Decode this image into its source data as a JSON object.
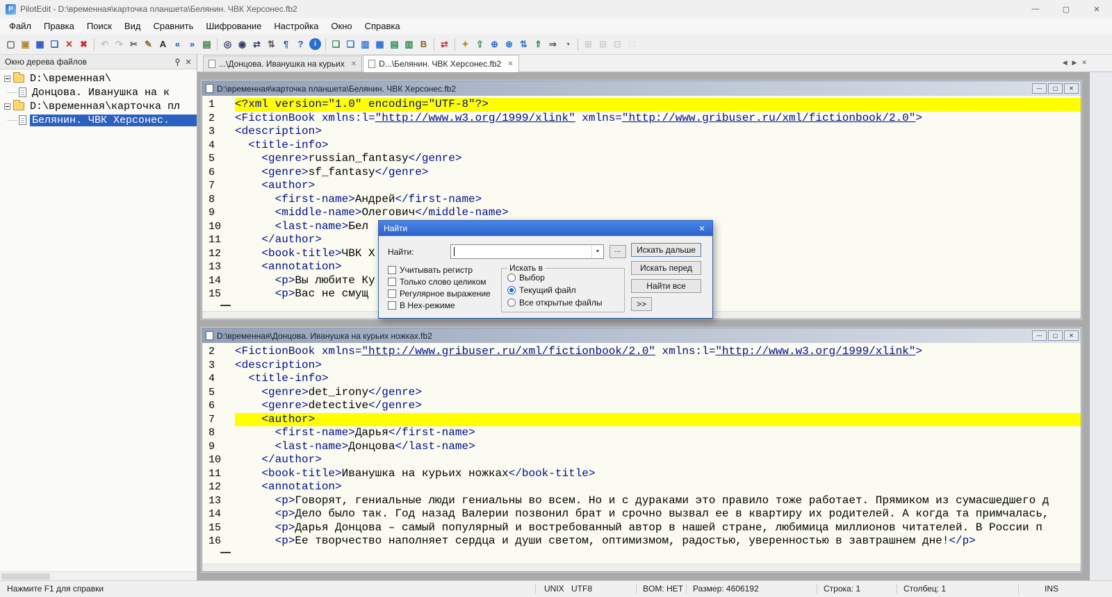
{
  "glyphs": {
    "minimize": "—",
    "maximize": "▢",
    "close": "✕",
    "dropdown": "▼",
    "back": "◀",
    "forward": "▶"
  },
  "titlebar": {
    "app_badge": "P",
    "title": "PilotEdit - D:\\временная\\карточка планшета\\Белянин. ЧВК Херсонес.fb2"
  },
  "menubar": {
    "items": [
      "Файл",
      "Правка",
      "Поиск",
      "Вид",
      "Сравнить",
      "Шифрование",
      "Настройка",
      "Окно",
      "Справка"
    ]
  },
  "toolbar": {
    "groups": [
      [
        {
          "name": "new-file",
          "glyph": "▢",
          "color": "#4a5a6a"
        },
        {
          "name": "open-file",
          "glyph": "▣",
          "color": "#b08830"
        },
        {
          "name": "save",
          "glyph": "▦",
          "color": "#2a52be"
        },
        {
          "name": "save-all",
          "glyph": "❏",
          "color": "#2a52be"
        },
        {
          "name": "close-file",
          "glyph": "✕",
          "color": "#c03030"
        },
        {
          "name": "close-all-files",
          "glyph": "✖",
          "color": "#c03030"
        }
      ],
      [
        {
          "name": "undo",
          "glyph": "↶",
          "color": "#777777",
          "disabled": true
        },
        {
          "name": "redo",
          "glyph": "↷",
          "color": "#777777",
          "disabled": true
        },
        {
          "name": "cut",
          "glyph": "✂",
          "color": "#555566"
        },
        {
          "name": "edit-pen",
          "glyph": "✎",
          "color": "#996633"
        },
        {
          "name": "font",
          "glyph": "A",
          "color": "#222233"
        },
        {
          "name": "prev-bookmark",
          "glyph": "«",
          "color": "#1a56b0"
        },
        {
          "name": "next-bookmark",
          "glyph": "»",
          "color": "#1a56b0"
        },
        {
          "name": "export-text",
          "glyph": "▤",
          "color": "#3a7a3a"
        }
      ],
      [
        {
          "name": "find",
          "glyph": "◎",
          "color": "#333a66"
        },
        {
          "name": "find-in-files",
          "glyph": "◉",
          "color": "#333a66"
        },
        {
          "name": "replace",
          "glyph": "⇄",
          "color": "#333a66"
        },
        {
          "name": "sort-lines",
          "glyph": "⇅",
          "color": "#555555"
        },
        {
          "name": "show-whitespace",
          "glyph": "¶",
          "color": "#3355aa"
        },
        {
          "name": "help",
          "glyph": "?",
          "color": "#1a56b0"
        },
        {
          "name": "about-info",
          "glyph": "i",
          "color": "#ffffff",
          "bg": "#2a6fd0"
        }
      ],
      [
        {
          "name": "copy-to-file",
          "glyph": "❏",
          "color": "#2a8a4a"
        },
        {
          "name": "paste-from-file",
          "glyph": "❏",
          "color": "#2a6fd0"
        },
        {
          "name": "file-group-a",
          "glyph": "▥",
          "color": "#2a6fd0"
        },
        {
          "name": "file-group-b",
          "glyph": "▦",
          "color": "#2a6fd0"
        },
        {
          "name": "column-mode",
          "glyph": "▤",
          "color": "#2a8a4a"
        },
        {
          "name": "column-insert",
          "glyph": "▥",
          "color": "#2a8a4a"
        },
        {
          "name": "edit-bookmark-b",
          "glyph": "B",
          "color": "#8a5a2a"
        }
      ],
      [
        {
          "name": "compare-files",
          "glyph": "⇄",
          "color": "#c03030"
        }
      ],
      [
        {
          "name": "encrypt-file",
          "glyph": "✦",
          "color": "#c09020"
        },
        {
          "name": "ftp-transfer",
          "glyph": "⇧",
          "color": "#2a8a4a"
        },
        {
          "name": "open-in-browser",
          "glyph": "⊕",
          "color": "#2a6fd0"
        },
        {
          "name": "web-search",
          "glyph": "⊛",
          "color": "#2a6fd0"
        },
        {
          "name": "sort-az",
          "glyph": "⇅",
          "color": "#2a6fd0"
        },
        {
          "name": "upload",
          "glyph": "⇑",
          "color": "#2a8a4a"
        },
        {
          "name": "indent",
          "glyph": "⇒",
          "color": "#555555"
        },
        {
          "name": "zoom",
          "glyph": "◔",
          "color": "#333a66"
        }
      ],
      [
        {
          "name": "tool-expand",
          "glyph": "⊞",
          "color": "#999999",
          "disabled": true
        },
        {
          "name": "tool-collapse",
          "glyph": "⊟",
          "color": "#999999",
          "disabled": true
        },
        {
          "name": "tool-target",
          "glyph": "⊡",
          "color": "#999999",
          "disabled": true
        },
        {
          "name": "tool-frame",
          "glyph": "□",
          "color": "#999999",
          "disabled": true
        }
      ]
    ]
  },
  "sidebar": {
    "title": "Окно дерева файлов",
    "tree": [
      {
        "label": "D:\\временная\\",
        "type": "folder",
        "level": 0
      },
      {
        "label": "Донцова. Иванушка на к",
        "type": "file",
        "level": 1
      },
      {
        "label": "D:\\временная\\карточка пл",
        "type": "folder",
        "level": 0
      },
      {
        "label": "Белянин. ЧВК Херсонес.",
        "type": "file",
        "level": 1,
        "selected": true
      }
    ]
  },
  "tabbar": {
    "tabs": [
      {
        "label": "...\\Донцова. Иванушка на курьих",
        "active": false
      },
      {
        "label": "D...\\Белянин. ЧВК Херсонес.fb2",
        "active": true
      }
    ]
  },
  "editors": [
    {
      "title": "D:\\временная\\карточка планшета\\Белянин. ЧВК Херсонес.fb2",
      "lines": [
        {
          "n": "1",
          "t": "<?xml version=\"1.0\" encoding=\"UTF-8\"?>",
          "hl": true
        },
        {
          "n": "2",
          "t": "<FictionBook xmlns:l=\"http://www.w3.org/1999/xlink\" xmlns=\"http://www.gribuser.ru/xml/fictionbook/2.0\">"
        },
        {
          "n": "3",
          "t": "<description>"
        },
        {
          "n": "4",
          "t": "  <title-info>"
        },
        {
          "n": "5",
          "t": "    <genre>russian_fantasy</genre>"
        },
        {
          "n": "6",
          "t": "    <genre>sf_fantasy</genre>"
        },
        {
          "n": "7",
          "t": "    <author>"
        },
        {
          "n": "8",
          "t": "      <first-name>Андрей</first-name>"
        },
        {
          "n": "9",
          "t": "      <middle-name>Олегович</middle-name>"
        },
        {
          "n": "10",
          "t": "      <last-name>Бел"
        },
        {
          "n": "11",
          "t": "    </author>"
        },
        {
          "n": "12",
          "t": "    <book-title>ЧВК Х"
        },
        {
          "n": "13",
          "t": "    <annotation>"
        },
        {
          "n": "14",
          "t": "      <p>Вы любите Ку"
        },
        {
          "n": "15",
          "t": "      <p>Вас не смущ"
        }
      ]
    },
    {
      "title": "D:\\временная\\Донцова. Иванушка на курьих ножках.fb2",
      "lines": [
        {
          "n": "2",
          "t": "<FictionBook xmlns=\"http://www.gribuser.ru/xml/fictionbook/2.0\" xmlns:l=\"http://www.w3.org/1999/xlink\">"
        },
        {
          "n": "3",
          "t": "<description>"
        },
        {
          "n": "4",
          "t": "  <title-info>"
        },
        {
          "n": "5",
          "t": "    <genre>det_irony</genre>"
        },
        {
          "n": "6",
          "t": "    <genre>detective</genre>"
        },
        {
          "n": "7",
          "t": "    <author>",
          "hl": true
        },
        {
          "n": "8",
          "t": "      <first-name>Дарья</first-name>"
        },
        {
          "n": "9",
          "t": "      <last-name>Донцова</last-name>"
        },
        {
          "n": "10",
          "t": "    </author>"
        },
        {
          "n": "11",
          "t": "    <book-title>Иванушка на курьих ножках</book-title>"
        },
        {
          "n": "12",
          "t": "    <annotation>"
        },
        {
          "n": "13",
          "t": "      <p>Говорят, гениальные люди гениальны во всем. Но и с дураками это правило тоже работает. Прямиком из сумасшедшего д"
        },
        {
          "n": "14",
          "t": "      <p>Дело было так. Год назад Валерии позвонил брат и срочно вызвал ее в квартиру их родителей. А когда та примчалась,"
        },
        {
          "n": "15",
          "t": "      <p>Дарья Донцова – самый популярный и востребованный автор в нашей стране, любимица миллионов читателей. В России п"
        },
        {
          "n": "16",
          "t": "      <p>Ее творчество наполняет сердца и души светом, оптимизмом, радостью, уверенностью в завтрашнем дне!</p>"
        }
      ]
    }
  ],
  "find_dialog": {
    "title": "Найти",
    "label": "Найти:",
    "input_value": "",
    "browse_label": "...",
    "buttons": [
      "Искать дальше",
      "Искать перед",
      "Найти все",
      ">>"
    ],
    "checkboxes": [
      {
        "label": "Учитывать регистр",
        "checked": false
      },
      {
        "label": "Только слово целиком",
        "checked": false
      },
      {
        "label": "Регулярное выражение",
        "checked": false
      },
      {
        "label": "В Hex-режиме",
        "checked": false
      }
    ],
    "group": {
      "label": "Искать в",
      "radios": [
        {
          "label": "Выбор",
          "selected": false
        },
        {
          "label": "Текущий файл",
          "selected": true
        },
        {
          "label": "Все открытые файлы",
          "selected": false
        }
      ]
    }
  },
  "statusbar": {
    "message": "Нажмите F1 для справки",
    "eol": "UNIX",
    "encoding": "UTF8",
    "bom": "BOM: НЕТ",
    "size": "Размер: 4606192",
    "line": "Строка: 1",
    "column": "Столбец: 1",
    "insert_mode": "INS"
  }
}
